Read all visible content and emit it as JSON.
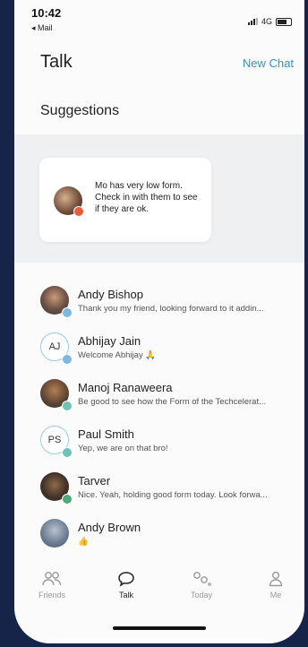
{
  "status_bar": {
    "time": "10:42",
    "back_label": "◂ Mail",
    "network": "4G"
  },
  "header": {
    "title": "Talk",
    "new_chat_label": "New Chat"
  },
  "suggestions": {
    "heading": "Suggestions",
    "card_text": "Mo has very low form. Check in with them to see if they are ok."
  },
  "chats": [
    {
      "name": "Andy Bishop",
      "preview": "Thank you my friend, looking forward to it addin...",
      "avatar": "photo",
      "badge": "blue"
    },
    {
      "name": "Abhijay Jain",
      "preview": "Welcome Abhijay 🙏",
      "avatar": "initials",
      "initials": "AJ",
      "badge": "blue"
    },
    {
      "name": "Manoj Ranaweera",
      "preview": "Be good to see how the Form of the Techcelerat...",
      "avatar": "photo",
      "badge": "teal"
    },
    {
      "name": "Paul Smith",
      "preview": "Yep, we are on that bro!",
      "avatar": "initials",
      "initials": "PS",
      "badge": "teal"
    },
    {
      "name": "Tarver",
      "preview": "Nice. Yeah, holding good form today. Look forwa...",
      "avatar": "photo",
      "badge": "green"
    },
    {
      "name": "Andy Brown",
      "preview": "👍",
      "avatar": "photo",
      "badge": "none"
    }
  ],
  "tabs": [
    {
      "label": "Friends",
      "icon": "friends-icon",
      "active": false
    },
    {
      "label": "Talk",
      "icon": "chat-bubble-icon",
      "active": true
    },
    {
      "label": "Today",
      "icon": "today-icon",
      "active": false
    },
    {
      "label": "Me",
      "icon": "person-icon",
      "active": false
    }
  ],
  "colors": {
    "accent": "#3a8fd6",
    "background": "#17244a",
    "badge_blue": "#7bb8e3",
    "badge_teal": "#6cc3b8",
    "badge_green": "#4fa87a",
    "alert": "#e85a3c"
  }
}
